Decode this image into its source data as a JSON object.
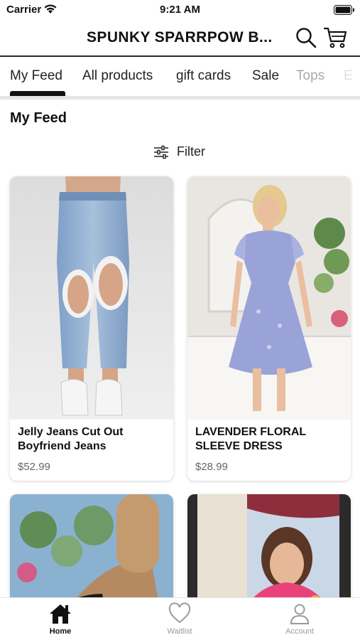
{
  "status_bar": {
    "carrier": "Carrier",
    "time": "9:21 AM"
  },
  "header": {
    "title": "SPUNKY SPARRPOW B..."
  },
  "tabs": [
    {
      "label": "My Feed",
      "active": true
    },
    {
      "label": "All products"
    },
    {
      "label": "gift cards"
    },
    {
      "label": "Sale"
    },
    {
      "label": "Tops"
    },
    {
      "label": "E"
    }
  ],
  "section": {
    "title": "My Feed"
  },
  "filter": {
    "label": "Filter",
    "icon": "sliders-icon"
  },
  "products": [
    {
      "name": "Jelly Jeans Cut Out Boyfriend Jeans",
      "price": "$52.99"
    },
    {
      "name": "LAVENDER FLORAL SLEEVE DRESS",
      "price": "$28.99"
    }
  ],
  "bottom_nav": [
    {
      "label": "Home",
      "icon": "home-icon",
      "active": true
    },
    {
      "label": "Waitlist",
      "icon": "heart-icon"
    },
    {
      "label": "Account",
      "icon": "person-icon"
    }
  ],
  "colors": {
    "accent": "#111111",
    "muted": "#9a9a9a",
    "divider": "#e6e6e6"
  }
}
